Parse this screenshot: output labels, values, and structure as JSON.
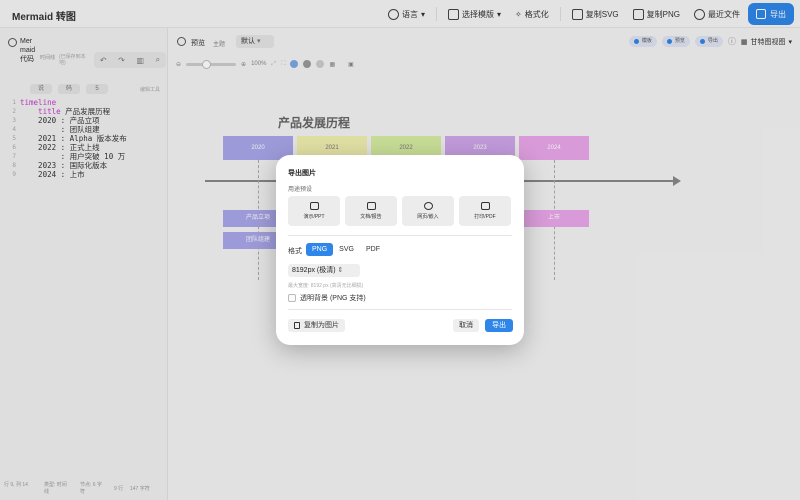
{
  "app": {
    "title": "Mermaid 转图"
  },
  "toolbar": {
    "language": "语言",
    "template": "选择模版",
    "format": "格式化",
    "copy_svg": "复制SVG",
    "copy_png": "复制PNG",
    "recent": "最近文件",
    "export": "导出"
  },
  "editor": {
    "title": "Mermaid代码",
    "tag_timeline": "时间线",
    "tag_note": "(已保存到本地)",
    "chip_1": "说",
    "chip_2": "码",
    "chip_3": "5",
    "hint": "编辑工具",
    "lines": [
      {
        "n": "1",
        "text": "timeline",
        "kw": true
      },
      {
        "n": "2",
        "text": "    title 产品发展历程",
        "kw": false
      },
      {
        "n": "3",
        "text": "    2020 : 产品立项",
        "kw": false
      },
      {
        "n": "4",
        "text": "         : 团队组建",
        "kw": false
      },
      {
        "n": "5",
        "text": "    2021 : Alpha 版本发布",
        "kw": false
      },
      {
        "n": "6",
        "text": "    2022 : 正式上线",
        "kw": false
      },
      {
        "n": "7",
        "text": "         : 用户突破 10 万",
        "kw": false
      },
      {
        "n": "8",
        "text": "    2023 : 国际化版本",
        "kw": false
      },
      {
        "n": "9",
        "text": "    2024 : 上市",
        "kw": false
      }
    ],
    "status": {
      "cursor": "行 9, 列 14",
      "type": "类型: 时间线",
      "nodes": "节点: 6 字符",
      "lines": "9 行",
      "chars": "147 字符"
    }
  },
  "preview": {
    "label": "预览",
    "theme_label": "主题",
    "theme_value": "默认",
    "pill_1": "模板",
    "pill_2": "预览",
    "pill_3": "导出",
    "view_mode": "甘特图视图",
    "zoom": "100%"
  },
  "diagram": {
    "title": "产品发展历程",
    "periods": [
      {
        "label": "2020",
        "color": "#a9a6ea"
      },
      {
        "label": "2021",
        "color": "#f2f0b0"
      },
      {
        "label": "2022",
        "color": "#d7eda2"
      },
      {
        "label": "2023",
        "color": "#cfa6ea"
      },
      {
        "label": "2024",
        "color": "#e9a6e9"
      }
    ],
    "events_2020": [
      "产品立项",
      "团队组建"
    ],
    "events_2024": [
      "上市"
    ]
  },
  "dialog": {
    "title": "导出图片",
    "preset_label": "用途预设",
    "presets": [
      "演示/PPT",
      "文档/报告",
      "网页/嵌入",
      "打印/PDF"
    ],
    "format_label": "格式",
    "formats": [
      "PNG",
      "SVG",
      "PDF"
    ],
    "selected_format": "PNG",
    "size": "8192px (极清)",
    "size_hint": "最大宽度: 8192 px (高清无比细损)",
    "transparent": "透明背景 (PNG 支持)",
    "copy": "复制为图片",
    "cancel": "取消",
    "confirm": "导出"
  },
  "colors": {
    "accent": "#2e86e8"
  }
}
